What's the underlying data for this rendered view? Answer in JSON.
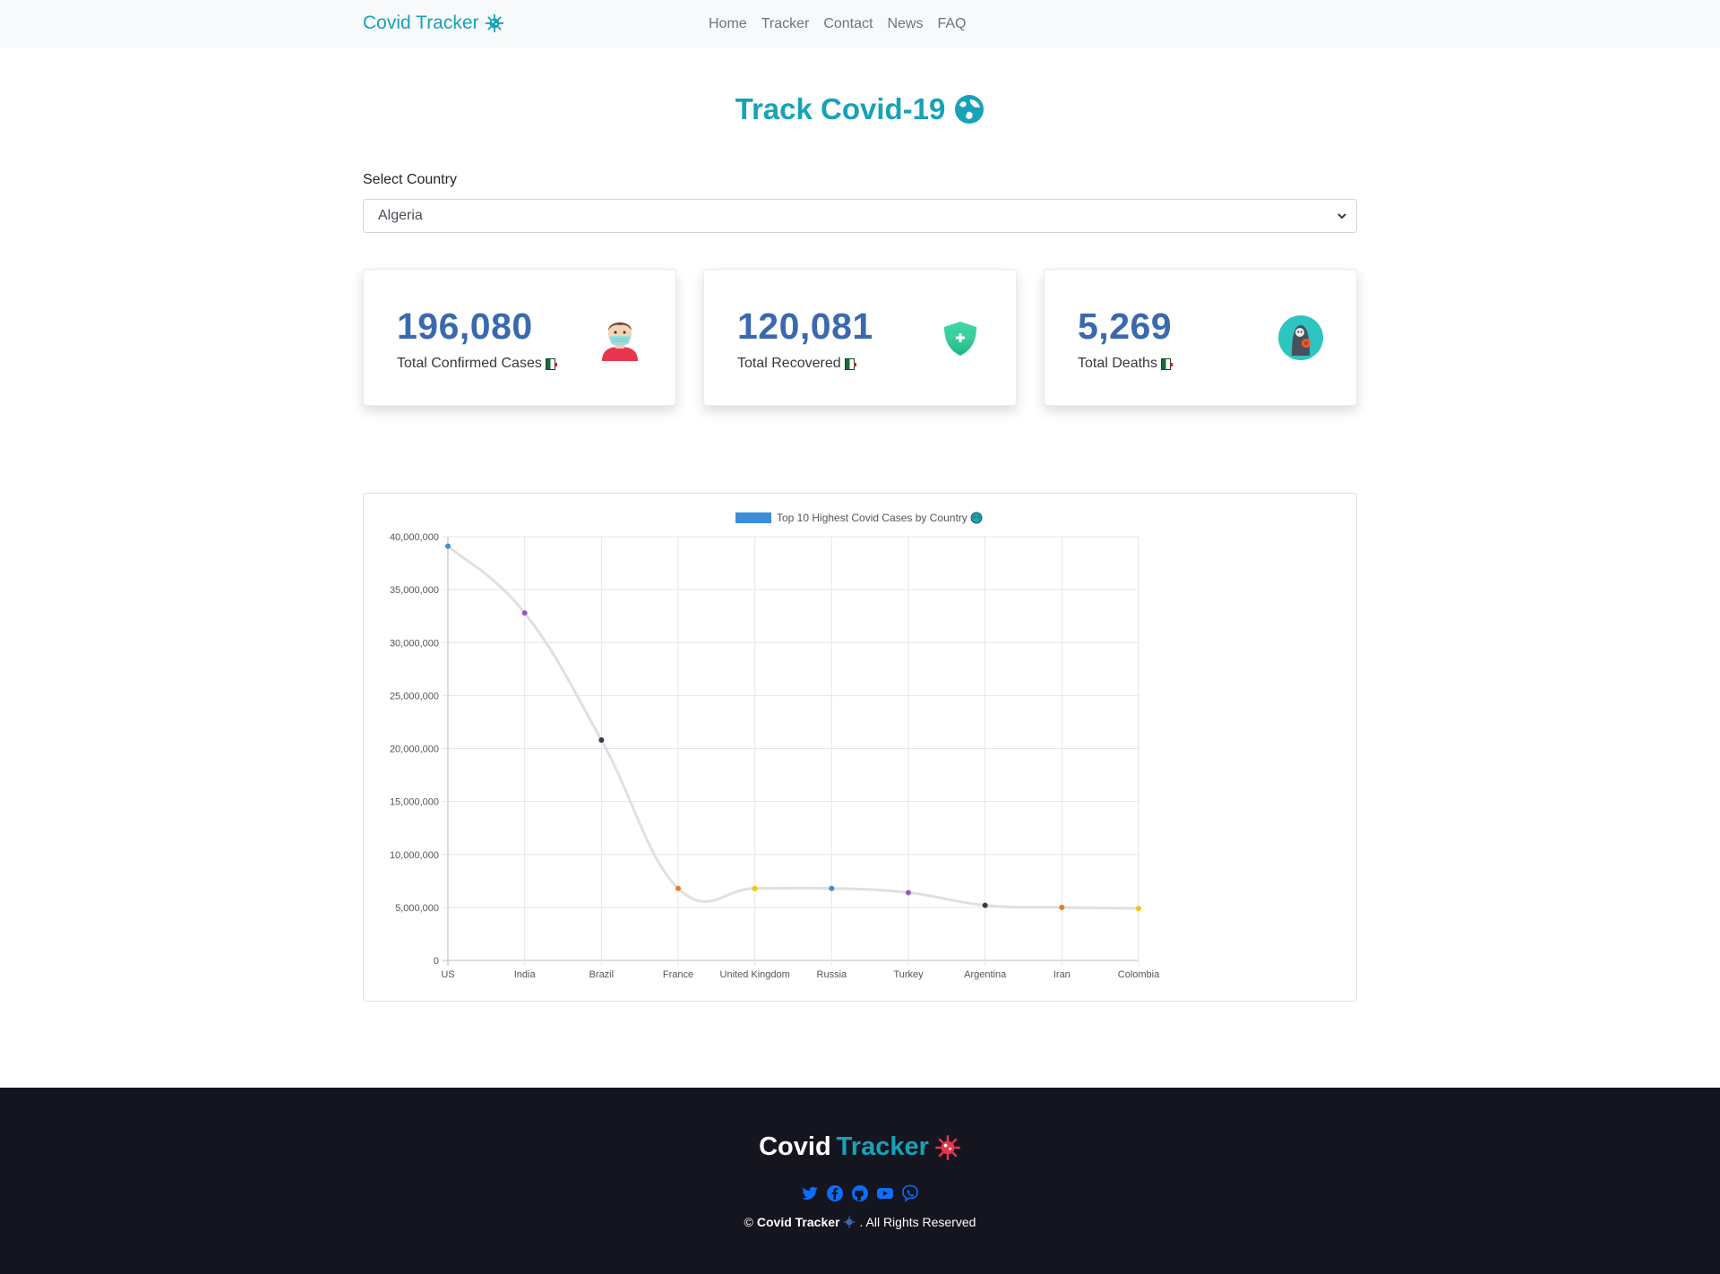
{
  "navbar": {
    "brand": "Covid Tracker",
    "links": [
      "Home",
      "Tracker",
      "Contact",
      "News",
      "FAQ"
    ]
  },
  "hero": {
    "title": "Track Covid-19"
  },
  "country_select": {
    "label": "Select Country",
    "value": "Algeria"
  },
  "cards": [
    {
      "number": "196,080",
      "label": "Total Confirmed Cases",
      "icon": "masked-person-icon"
    },
    {
      "number": "120,081",
      "label": "Total Recovered",
      "icon": "shield-plus-icon"
    },
    {
      "number": "5,269",
      "label": "Total Deaths",
      "icon": "grim-reaper-icon"
    }
  ],
  "chart_data": {
    "type": "line",
    "legend": "Top 10 Highest Covid Cases by Country",
    "legend_position": "top-center",
    "categories": [
      "US",
      "India",
      "Brazil",
      "France",
      "United Kingdom",
      "Russia",
      "Turkey",
      "Argentina",
      "Iran",
      "Colombia"
    ],
    "values": [
      39100000,
      32800000,
      20800000,
      6800000,
      6800000,
      6800000,
      6400000,
      5200000,
      5000000,
      4900000
    ],
    "point_colors": [
      "#3a8fd6",
      "#9b59b6",
      "#2c3e50",
      "#e67e22",
      "#f1c40f",
      "#3a8fd6",
      "#9b59b6",
      "#2c3e50",
      "#e67e22",
      "#f1c40f"
    ],
    "line_color": "#e0e0e0",
    "y_ticks": [
      "0",
      "5,000,000",
      "10,000,000",
      "15,000,000",
      "20,000,000",
      "25,000,000",
      "30,000,000",
      "35,000,000",
      "40,000,000"
    ],
    "ylim": [
      0,
      40000000
    ],
    "grid": true
  },
  "footer": {
    "brand_a": "Covid",
    "brand_b": "Tracker",
    "copyright_symbol": "©",
    "copyright_brand": "Covid Tracker",
    "copyright_rest": ". All Rights Reserved",
    "social_icons": [
      "twitter-icon",
      "facebook-icon",
      "github-icon",
      "youtube-icon",
      "viber-icon"
    ]
  },
  "colors": {
    "accent": "#17a2b8",
    "number": "#3a6aad",
    "footer_bg": "#14151f",
    "social": "#0d6efd"
  }
}
